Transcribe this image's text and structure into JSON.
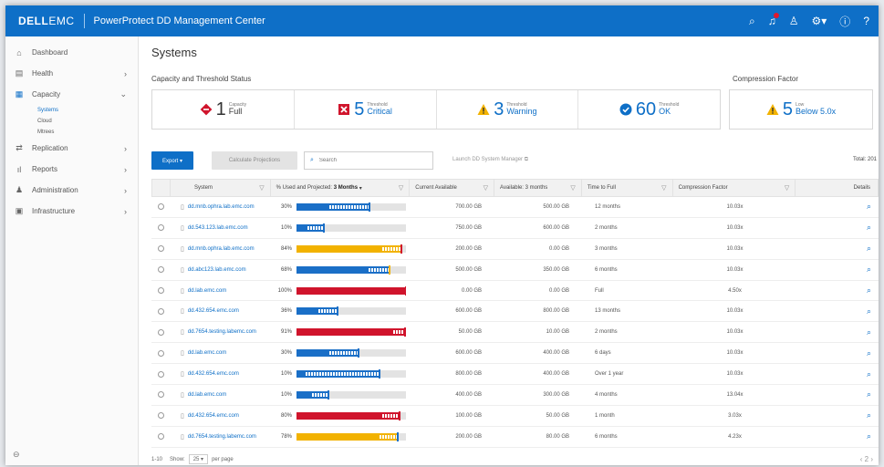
{
  "header": {
    "logo": "DELL",
    "logo_suffix": "EMC",
    "app_title": "PowerProtect DD Management Center",
    "icons": [
      "search-icon",
      "alert-icon",
      "user-icon",
      "settings-icon",
      "info-icon",
      "help-icon"
    ]
  },
  "sidebar": {
    "items": [
      {
        "label": "Dashboard",
        "icon": "home-icon"
      },
      {
        "label": "Health",
        "icon": "health-icon",
        "chevron": "›"
      },
      {
        "label": "Capacity",
        "icon": "capacity-icon",
        "chevron": "⌄"
      },
      {
        "label": "Replication",
        "icon": "replication-icon",
        "chevron": "›"
      },
      {
        "label": "Reports",
        "icon": "reports-icon",
        "chevron": "›"
      },
      {
        "label": "Administration",
        "icon": "admin-icon",
        "chevron": "›"
      },
      {
        "label": "Infrastructure",
        "icon": "infra-icon",
        "chevron": "›"
      }
    ],
    "subitems": [
      "Systems",
      "Cloud",
      "Mtrees"
    ]
  },
  "page": {
    "title": "Systems",
    "capacity_section_title": "Capacity and Threshold Status",
    "compression_section_title": "Compression Factor"
  },
  "status_cards": [
    {
      "value": "1",
      "small": "Capacity",
      "label": "Full",
      "color": "#d0142c"
    },
    {
      "value": "5",
      "small": "Threshold",
      "label": "Critical",
      "color": "#d0142c"
    },
    {
      "value": "3",
      "small": "Threshold",
      "label": "Warning",
      "color": "#f2b200"
    },
    {
      "value": "60",
      "small": "Threshold",
      "label": "OK",
      "color": "#0e6fc7"
    }
  ],
  "compression_card": {
    "value": "5",
    "small": "Low",
    "label": "Below 5.0x",
    "color": "#f2b200"
  },
  "toolbar": {
    "export_label": "Export ▾",
    "calc_label": "Calculate Projections",
    "search_placeholder": "Search",
    "launch_label": "Launch DD System Manager ⧉",
    "total_label": "Total: 201"
  },
  "table": {
    "headers": {
      "system": "System",
      "pct": "% Used and Projected:",
      "pct_period": "3 Months",
      "current": "Current Available",
      "avail3": "Available: 3 months",
      "ttf": "Time to Full",
      "cf": "Compression Factor",
      "details": "Details"
    },
    "rows": [
      {
        "system": "dd.mnb.ophra.lab.emc.com",
        "pct": "30%",
        "used": 0.3,
        "proj": 0.66,
        "color": "#1a6fc7",
        "tick": "#1a6fc7",
        "current": "700.00 GB",
        "avail3": "500.00 GB",
        "ttf": "12 months",
        "cf": "10.03x"
      },
      {
        "system": "dd.543.123.lab.emc.com",
        "pct": "10%",
        "used": 0.1,
        "proj": 0.24,
        "color": "#1a6fc7",
        "tick": "#1a6fc7",
        "current": "750.00 GB",
        "avail3": "600.00 GB",
        "ttf": "2 months",
        "cf": "10.03x"
      },
      {
        "system": "dd.mnb.ophra.lab.emc.com",
        "pct": "84%",
        "used": 0.78,
        "proj": 0.95,
        "color": "#f2b200",
        "tick": "#d0142c",
        "current": "200.00 GB",
        "avail3": "0.00 GB",
        "ttf": "3 months",
        "cf": "10.03x"
      },
      {
        "system": "dd.abc123.lab.emc.com",
        "pct": "68%",
        "used": 0.66,
        "proj": 0.84,
        "color": "#1a6fc7",
        "tick": "#f2b200",
        "current": "500.00 GB",
        "avail3": "350.00 GB",
        "ttf": "6 months",
        "cf": "10.03x"
      },
      {
        "system": "dd.lab.emc.com",
        "pct": "100%",
        "used": 1.0,
        "proj": 1.0,
        "color": "#d0142c",
        "tick": "#d0142c",
        "current": "0.00 GB",
        "avail3": "0.00 GB",
        "ttf": "Full",
        "cf": "4.50x"
      },
      {
        "system": "dd.432.654.emc.com",
        "pct": "36%",
        "used": 0.2,
        "proj": 0.37,
        "color": "#1a6fc7",
        "tick": "#1a6fc7",
        "current": "600.00 GB",
        "avail3": "800.00 GB",
        "ttf": "13 months",
        "cf": "10.03x"
      },
      {
        "system": "dd.7654.testing.labemc.com",
        "pct": "91%",
        "used": 0.88,
        "proj": 0.98,
        "color": "#d0142c",
        "tick": "#d0142c",
        "current": "50.00 GB",
        "avail3": "10.00 GB",
        "ttf": "2 months",
        "cf": "10.03x"
      },
      {
        "system": "dd.lab.emc.com",
        "pct": "30%",
        "used": 0.3,
        "proj": 0.56,
        "color": "#1a6fc7",
        "tick": "#1a6fc7",
        "current": "600.00 GB",
        "avail3": "400.00 GB",
        "ttf": "6 days",
        "cf": "10.03x"
      },
      {
        "system": "dd.432.654.emc.com",
        "pct": "10%",
        "used": 0.08,
        "proj": 0.75,
        "color": "#1a6fc7",
        "tick": "#1a6fc7",
        "current": "800.00 GB",
        "avail3": "400.00 GB",
        "ttf": "Over 1 year",
        "cf": "10.03x"
      },
      {
        "system": "dd.lab.emc.com",
        "pct": "10%",
        "used": 0.14,
        "proj": 0.28,
        "color": "#1a6fc7",
        "tick": "#1a6fc7",
        "current": "400.00 GB",
        "avail3": "300.00 GB",
        "ttf": "4 months",
        "cf": "13.04x"
      },
      {
        "system": "dd.432.654.emc.com",
        "pct": "80%",
        "used": 0.78,
        "proj": 0.93,
        "color": "#d0142c",
        "tick": "#d0142c",
        "current": "100.00 GB",
        "avail3": "50.00 GB",
        "ttf": "1 month",
        "cf": "3.03x"
      },
      {
        "system": "dd.7654.testing.labemc.com",
        "pct": "78%",
        "used": 0.76,
        "proj": 0.92,
        "color": "#f2b200",
        "tick": "#1a6fc7",
        "current": "200.00 GB",
        "avail3": "80.00 GB",
        "ttf": "6 months",
        "cf": "4.23x"
      }
    ]
  },
  "pager": {
    "range": "1-10",
    "show_label": "Show:",
    "page_size": "25",
    "per_page_label": "per page",
    "nav": "‹  2  ›"
  }
}
